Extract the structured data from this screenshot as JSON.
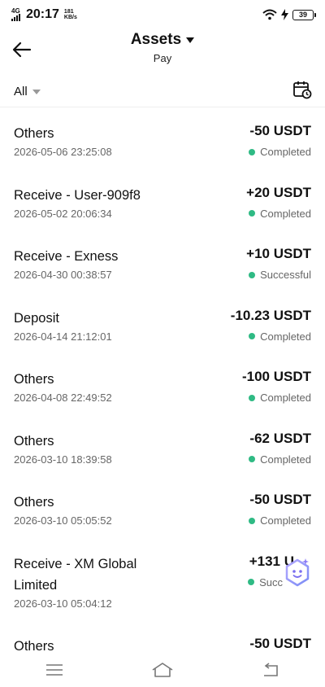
{
  "status_bar": {
    "network": "4G",
    "time": "20:17",
    "speed_value": "181",
    "speed_unit": "KB/s",
    "battery": "39",
    "icons": [
      "signal-icon",
      "wifi-icon",
      "charging-icon",
      "battery-icon"
    ]
  },
  "header": {
    "title": "Assets",
    "subtitle": "Pay"
  },
  "filter": {
    "label": "All"
  },
  "colors": {
    "status_green": "#2fba84",
    "assistant_accent": "#8b7cf6"
  },
  "transactions": [
    {
      "name": "Others",
      "date": "2026-05-06 23:25:08",
      "amount": "-50 USDT",
      "status": "Completed"
    },
    {
      "name": "Receive - User-909f8",
      "date": "2026-05-02 20:06:34",
      "amount": "+20 USDT",
      "status": "Completed"
    },
    {
      "name": "Receive - Exness",
      "date": "2026-04-30 00:38:57",
      "amount": "+10 USDT",
      "status": "Successful"
    },
    {
      "name": "Deposit",
      "date": "2026-04-14 21:12:01",
      "amount": "-10.23 USDT",
      "status": "Completed"
    },
    {
      "name": "Others",
      "date": "2026-04-08 22:49:52",
      "amount": "-100 USDT",
      "status": "Completed"
    },
    {
      "name": "Others",
      "date": "2026-03-10 18:39:58",
      "amount": "-62 USDT",
      "status": "Completed"
    },
    {
      "name": "Others",
      "date": "2026-03-10 05:05:52",
      "amount": "-50 USDT",
      "status": "Completed"
    },
    {
      "name": "Receive - XM Global Limited",
      "date": "2026-03-10 05:04:12",
      "amount": "+131 U",
      "status": "Succ"
    },
    {
      "name": "Others",
      "date": "",
      "amount": "-50 USDT",
      "status": ""
    }
  ],
  "nav": {
    "icons": [
      "menu-icon",
      "home-icon",
      "back-icon"
    ]
  }
}
